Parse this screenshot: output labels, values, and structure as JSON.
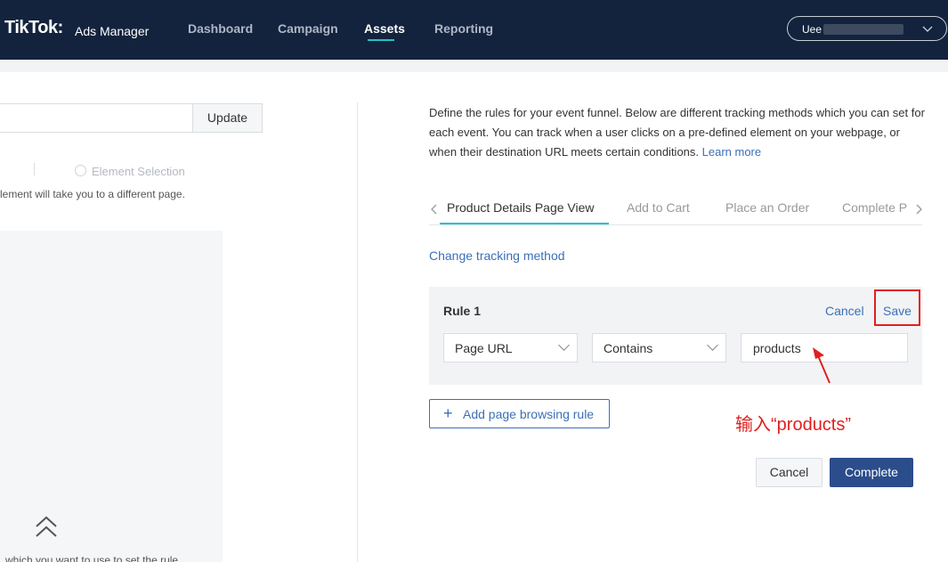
{
  "header": {
    "logo": "TikTok:",
    "logo_sub": "Ads Manager",
    "nav": [
      "Dashboard",
      "Campaign",
      "Assets",
      "Reporting"
    ],
    "active_nav": "Assets",
    "user_prefix": "Uee",
    "user_chevron_icon": "chevron-down-icon"
  },
  "left_panel": {
    "update_label": "Update",
    "radio_label": "Element Selection",
    "hint": "lement will take you to a different page.",
    "bottom_hint": "which you want to use to set the rule"
  },
  "right_panel": {
    "description": "Define the rules for your event funnel. Below are different tracking methods which you can set for each event. You can track when a user clicks on a pre-defined element on your webpage, or when their destination URL meets certain conditions.",
    "learn_more": "Learn more",
    "tabs": [
      "Product Details Page View",
      "Add to Cart",
      "Place an Order",
      "Complete P"
    ],
    "active_tab": "Product Details Page View",
    "change_tracking": "Change tracking method",
    "rule": {
      "title": "Rule 1",
      "cancel": "Cancel",
      "save": "Save",
      "field": "Page URL",
      "operator": "Contains",
      "value": "products"
    },
    "add_rule": "Add page browsing rule",
    "annotation": "输入“products”",
    "cancel_label": "Cancel",
    "complete_label": "Complete"
  },
  "colors": {
    "topbar": "#13233d",
    "accent": "#25c2c9",
    "link": "#3b6fb6",
    "primary_button": "#2b4d8c",
    "annotation": "#e0201e"
  }
}
